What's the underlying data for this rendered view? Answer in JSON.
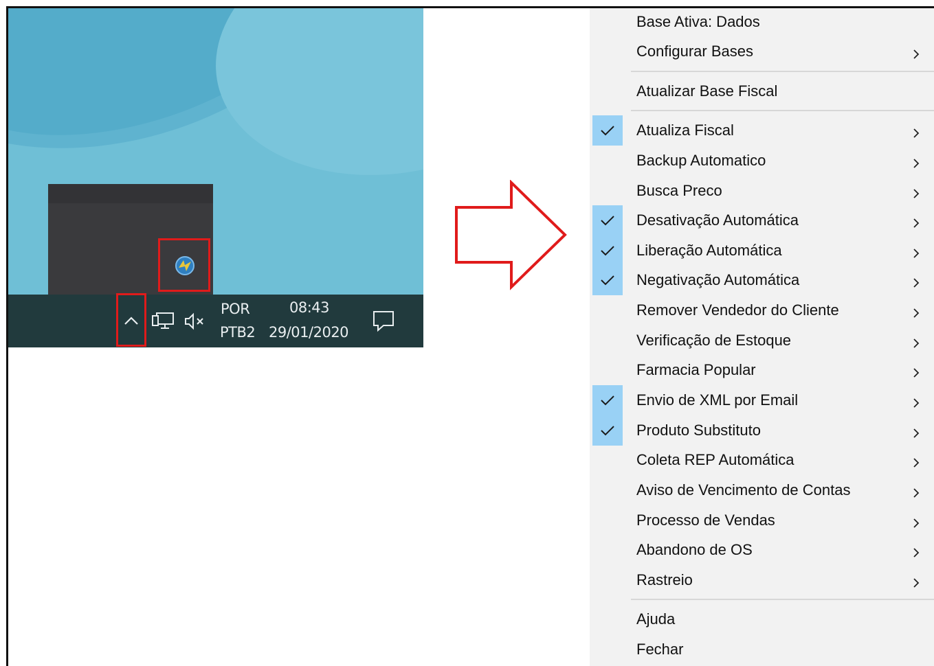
{
  "taskbar": {
    "language_top": "POR",
    "language_bottom": "PTB2",
    "time": "08:43",
    "date": "29/01/2020",
    "icons": [
      "show-hidden-icons-chevron-icon",
      "network-icon",
      "volume-muted-icon",
      "notifications-icon"
    ]
  },
  "tray_popup": {
    "app_icon": "app-tray-icon"
  },
  "colors": {
    "highlight_red": "#e01b1b",
    "check_bg": "#99d1f5",
    "menu_bg": "#f2f2f2",
    "taskbar_bg": "#213a3d"
  },
  "menu": {
    "items": [
      {
        "label": "Base Ativa: Dados",
        "checked": false,
        "submenu": false
      },
      {
        "label": "Configurar Bases",
        "checked": false,
        "submenu": true
      },
      {
        "label": "Atualizar Base Fiscal",
        "checked": false,
        "submenu": false
      },
      {
        "label": "Atualiza Fiscal",
        "checked": true,
        "submenu": true
      },
      {
        "label": "Backup Automatico",
        "checked": false,
        "submenu": true
      },
      {
        "label": "Busca Preco",
        "checked": false,
        "submenu": true
      },
      {
        "label": "Desativação Automática",
        "checked": true,
        "submenu": true
      },
      {
        "label": "Liberação Automática",
        "checked": true,
        "submenu": true
      },
      {
        "label": "Negativação Automática",
        "checked": true,
        "submenu": true
      },
      {
        "label": "Remover Vendedor do Cliente",
        "checked": false,
        "submenu": true
      },
      {
        "label": "Verificação de Estoque",
        "checked": false,
        "submenu": true
      },
      {
        "label": "Farmacia Popular",
        "checked": false,
        "submenu": true
      },
      {
        "label": "Envio de XML por Email",
        "checked": true,
        "submenu": true
      },
      {
        "label": "Produto Substituto",
        "checked": true,
        "submenu": true
      },
      {
        "label": "Coleta REP Automática",
        "checked": false,
        "submenu": true
      },
      {
        "label": "Aviso de Vencimento de Contas",
        "checked": false,
        "submenu": true
      },
      {
        "label": "Processo de Vendas",
        "checked": false,
        "submenu": true
      },
      {
        "label": "Abandono de OS",
        "checked": false,
        "submenu": true
      },
      {
        "label": "Rastreio",
        "checked": false,
        "submenu": true
      },
      {
        "label": "Ajuda",
        "checked": false,
        "submenu": false
      },
      {
        "label": "Fechar",
        "checked": false,
        "submenu": false
      }
    ]
  }
}
